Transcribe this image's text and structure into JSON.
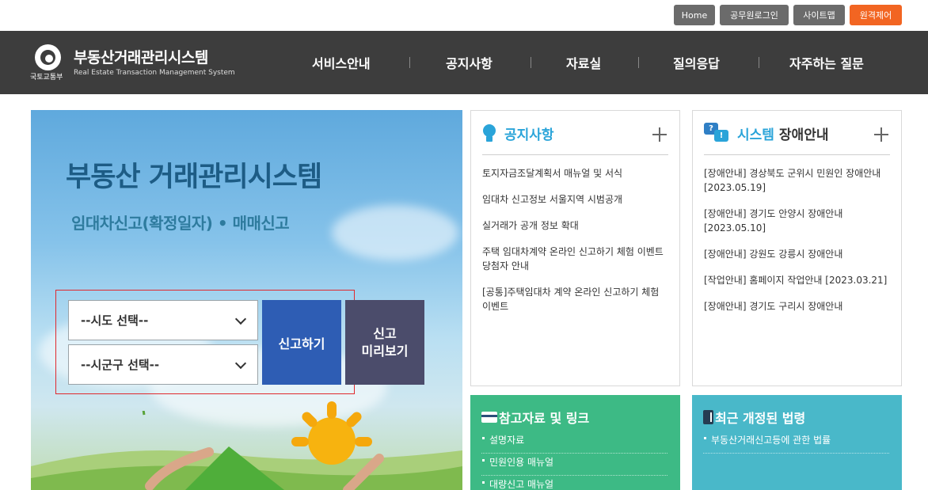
{
  "util_nav": {
    "home": "Home",
    "official_login": "공무원로그인",
    "sitemap": "사이트맵",
    "remote": "원격제어"
  },
  "header": {
    "ministry": "국토교통부",
    "title": "부동산거래관리시스템",
    "subtitle": "Real Estate Transaction Management System",
    "menu": [
      "서비스안내",
      "공지사항",
      "자료실",
      "질의응답",
      "자주하는 질문"
    ]
  },
  "hero": {
    "title": "부동산 거래관리시스템",
    "subtitle": "임대차신고(확정일자) • 매매신고",
    "sido_select": "--시도 선택--",
    "sigungu_select": "--시군구 선택--",
    "report_button": "신고하기",
    "preview_button_line1": "신고",
    "preview_button_line2": "미리보기"
  },
  "notice": {
    "title": "공지사항",
    "items": [
      "토지자금조달계획서 매뉴얼 및 서식",
      "임대차 신고정보 서울지역 시범공개",
      "실거래가 공개 정보 확대",
      "주택 임대차계약 온라인 신고하기 체험 이벤트 당첨자 안내",
      "[공통]주택임대차 계약 온라인 신고하기 체험 이벤트"
    ]
  },
  "outage": {
    "title_accent": "시스템",
    "title_rest": "장애안내",
    "items": [
      "[장애안내] 경상북도 군위시 민원인 장애안내 [2023.05.19]",
      "[장애안내] 경기도 안양시 장애안내 [2023.05.10]",
      "[장애안내] 강원도 강릉시 장애안내",
      "[작업안내] 홈페이지 작업안내 [2023.03.21]",
      "[장애안내] 경기도 구리시 장애안내"
    ]
  },
  "references": {
    "title": "참고자료 및 링크",
    "items": [
      "설명자료",
      "민원인용 매뉴얼",
      "대량신고 매뉴얼"
    ]
  },
  "laws": {
    "title": "최근 개정된 법령",
    "items": [
      "부동산거래신고등에 관한 법률"
    ]
  },
  "colors": {
    "header_bg": "#3d3d3d",
    "remote_button": "#f26522",
    "report_button": "#2e5db4",
    "preview_button": "#4b4c6b",
    "notice_accent": "#2aa4d9",
    "references_bg": "#3dba85",
    "laws_bg": "#49b8c9"
  },
  "icons": {
    "notice": "lightbulb-icon",
    "outage": "chat-bubbles-icon",
    "references": "card-icon",
    "laws": "book-icon",
    "more": "plus-icon",
    "select": "chevron-down-icon"
  }
}
